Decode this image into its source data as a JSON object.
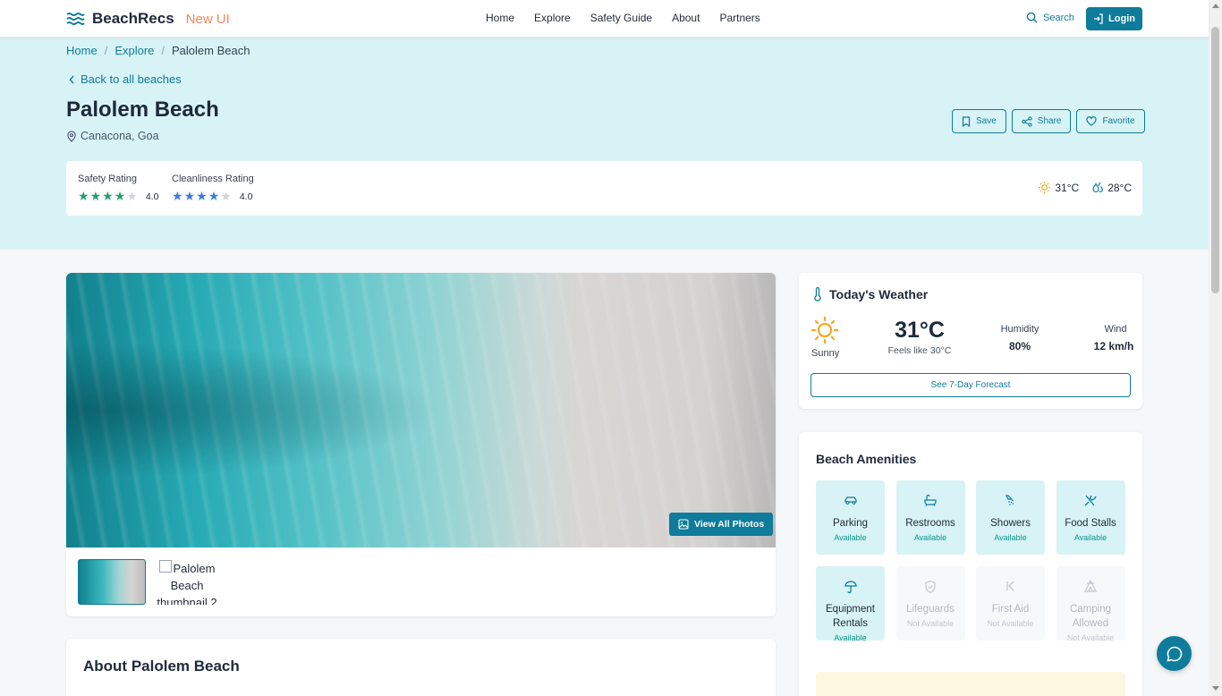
{
  "brand": {
    "name": "BeachRecs",
    "tag": "New UI",
    "accent": "#0e7c9a",
    "tag_color": "#f08a5d"
  },
  "nav": {
    "links": [
      "Home",
      "Explore",
      "Safety Guide",
      "About",
      "Partners"
    ],
    "search_label": "Search",
    "login_label": "Login"
  },
  "breadcrumb": {
    "items": [
      "Home",
      "Explore",
      "Palolem Beach"
    ]
  },
  "back_link": "Back to all beaches",
  "beach": {
    "name": "Palolem Beach",
    "location": "Canacona, Goa"
  },
  "actions": {
    "save": "Save",
    "share": "Share",
    "favorite": "Favorite"
  },
  "ratings": {
    "safety": {
      "label": "Safety Rating",
      "value": "4.0",
      "stars": 4,
      "color": "#22a06b"
    },
    "cleanliness": {
      "label": "Cleanliness Rating",
      "value": "4.0",
      "stars": 4,
      "color": "#3b7ddd"
    },
    "air_temp": "31°C",
    "water_temp": "28°C"
  },
  "gallery": {
    "view_all": "View All Photos",
    "thumb2_alt": "Palolem Beach thumbnail 2"
  },
  "about": {
    "title": "About Palolem Beach"
  },
  "weather": {
    "title": "Today's Weather",
    "condition": "Sunny",
    "temp": "31°C",
    "feels_like": "Feels like 30°C",
    "humidity_label": "Humidity",
    "humidity": "80%",
    "wind_label": "Wind",
    "wind": "12 km/h",
    "forecast_button": "See 7-Day Forecast"
  },
  "amenities": {
    "title": "Beach Amenities",
    "items": [
      {
        "name": "Parking",
        "status": "Available",
        "icon": "car-icon"
      },
      {
        "name": "Restrooms",
        "status": "Available",
        "icon": "bath-icon"
      },
      {
        "name": "Showers",
        "status": "Available",
        "icon": "shower-icon"
      },
      {
        "name": "Food Stalls",
        "status": "Available",
        "icon": "utensils-icon"
      },
      {
        "name": "Equipment Rentals",
        "status": "Available",
        "icon": "umbrella-icon"
      },
      {
        "name": "Lifeguards",
        "status": "Not Available",
        "icon": "shield-icon"
      },
      {
        "name": "First Aid",
        "status": "Not Available",
        "icon": "first-aid-icon"
      },
      {
        "name": "Camping Allowed",
        "status": "Not Available",
        "icon": "tent-icon"
      }
    ]
  }
}
